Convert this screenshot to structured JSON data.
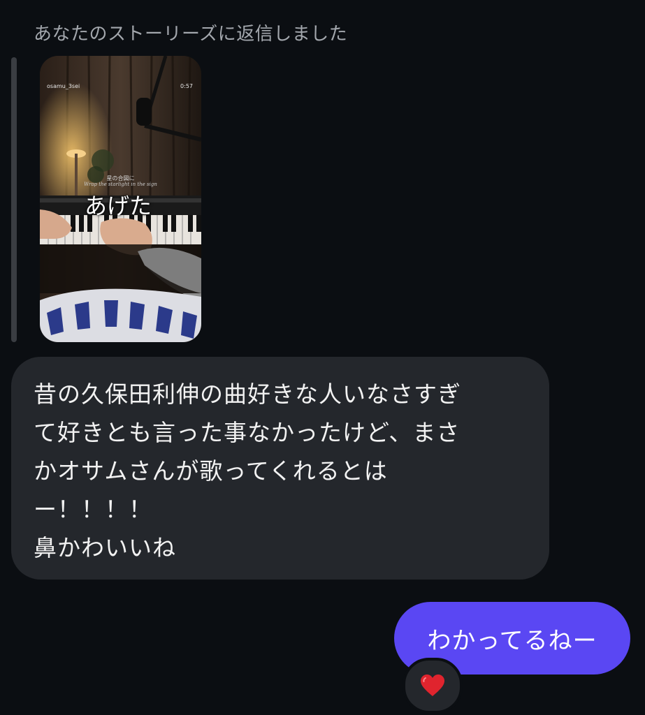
{
  "reply_header": "あなたのストーリーズに返信しました",
  "story": {
    "username": "osamu_3sei",
    "time": "0:57",
    "subtitle_jp": "星の合図に",
    "subtitle_en": "Wrap the starlight in the sign",
    "sticker_text": "あげた"
  },
  "messages": [
    {
      "sender": "other",
      "text": "昔の久保田利伸の曲好きな人いなさすぎ\nて好きとも言った事なかったけど、まさ\nかオサムさんが歌ってくれるとは\nー！！！！\n鼻かわいいね"
    },
    {
      "sender": "me",
      "text": "わかってるねー"
    }
  ],
  "reaction": {
    "icon": "red-heart-icon",
    "color": "#e0242e"
  },
  "colors": {
    "background": "#0b0e12",
    "incoming_bubble": "#24272c",
    "outgoing_bubble": "#5a47f3"
  }
}
